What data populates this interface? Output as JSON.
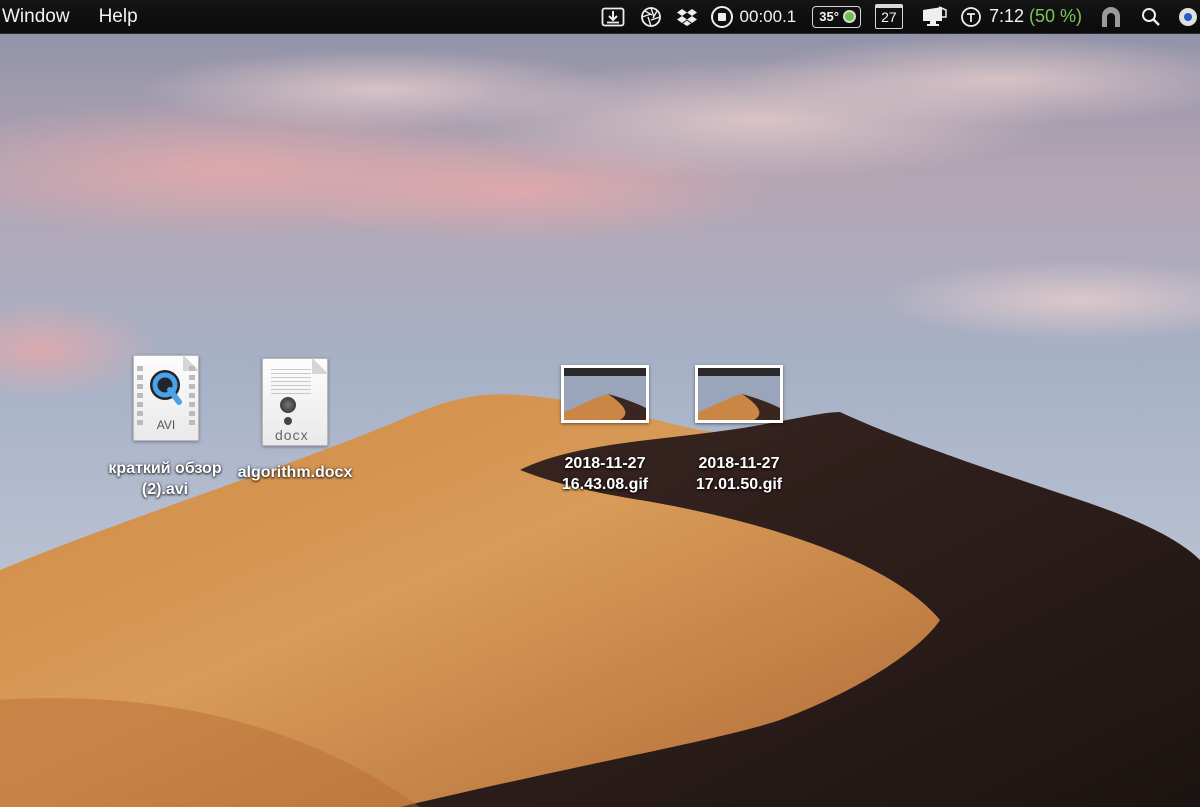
{
  "menubar": {
    "menus": [
      "Window",
      "Help"
    ],
    "tray": {
      "download_icon": "download-tray-icon",
      "aperture_icon": "aperture-icon",
      "dropbox_icon": "dropbox-icon",
      "recording_time": "00:00.1",
      "temperature": "35°",
      "calendar_day": "27",
      "time": "7:12",
      "battery_percent": "(50 %)"
    }
  },
  "desktop": {
    "icons": [
      {
        "kind": "avi",
        "type_badge": "AVI",
        "label_line1": "краткий обзор",
        "label_line2": "(2).avi"
      },
      {
        "kind": "docx",
        "type_badge": "docx",
        "label_line1": "algorithm.docx",
        "label_line2": ""
      },
      {
        "kind": "gif",
        "label_line1": "2018-11-27",
        "label_line2": "16.43.08.gif"
      },
      {
        "kind": "gif",
        "label_line1": "2018-11-27",
        "label_line2": "17.01.50.gif"
      }
    ]
  },
  "colors": {
    "menubar_bg": "#0f0f0f",
    "battery_green": "#7ec45a",
    "dune_light": "#d79a55",
    "dune_shadow": "#2a1c19",
    "sky": "#9aa6bd"
  }
}
